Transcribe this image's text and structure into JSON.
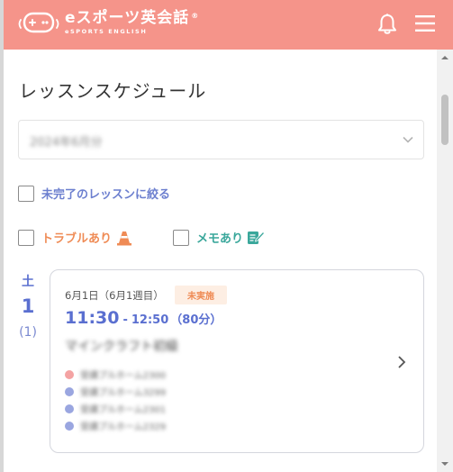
{
  "header": {
    "logo_main": "eスポーツ英会話",
    "logo_reg": "®",
    "logo_sub": "eSPORTS ENGLISH",
    "bell_icon": "bell-icon",
    "menu_icon": "hamburger-menu-icon",
    "background_color": "#f5948a"
  },
  "page": {
    "title": "レッスンスケジュール"
  },
  "month_select": {
    "value": "2024年6月分",
    "icon": "chevron-down-icon"
  },
  "filters": {
    "incomplete_label": "未完了のレッスンに絞る",
    "trouble_label": "トラブルあり",
    "memo_label": "メモあり",
    "incomplete_color": "#6c7fcf",
    "trouble_color": "#ef8b55",
    "memo_color": "#3aa79b"
  },
  "lesson": {
    "day_of_week": "土",
    "day": "1",
    "week_number": "(1)",
    "date_text": "6月1日（6月1週目）",
    "status_badge": "未実施",
    "start_time": "11:30",
    "separator": "-",
    "end_time": "12:50",
    "duration": "（80分）",
    "course_name": "マインクラフト初級",
    "members": [
      {
        "name": "受講プルホーム2300",
        "dot_color": "#f4a3a3"
      },
      {
        "name": "受講プルホーム3299",
        "dot_color": "#9aa6e0"
      },
      {
        "name": "受講プルホーム2301",
        "dot_color": "#9aa6e0"
      },
      {
        "name": "受講プルホーム2329",
        "dot_color": "#9aa6e0"
      }
    ]
  }
}
